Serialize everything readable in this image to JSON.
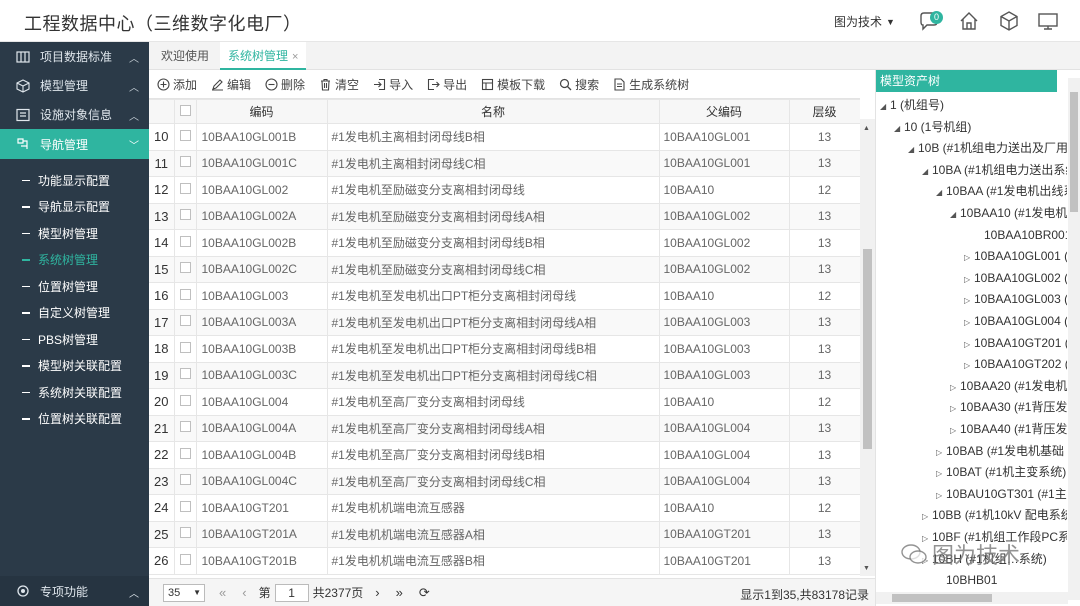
{
  "header": {
    "title": "工程数据中心（三维数字化电厂）",
    "user": "图为技术",
    "message_count": "0"
  },
  "sidebar": {
    "items": [
      {
        "label": "项目数据标准",
        "icon": "grid-icon"
      },
      {
        "label": "模型管理",
        "icon": "cube-icon"
      },
      {
        "label": "设施对象信息",
        "icon": "form-icon"
      },
      {
        "label": "导航管理",
        "icon": "navigation-icon"
      }
    ],
    "sub_items": [
      {
        "label": "功能显示配置"
      },
      {
        "label": "导航显示配置"
      },
      {
        "label": "模型树管理"
      },
      {
        "label": "系统树管理"
      },
      {
        "label": "位置树管理"
      },
      {
        "label": "自定义树管理"
      },
      {
        "label": "PBS树管理"
      },
      {
        "label": "模型树关联配置"
      },
      {
        "label": "系统树关联配置"
      },
      {
        "label": "位置树关联配置"
      }
    ],
    "bottom": {
      "label": "专项功能"
    }
  },
  "tabs": [
    {
      "label": "欢迎使用"
    },
    {
      "label": "系统树管理",
      "close": "×"
    }
  ],
  "toolbar": {
    "add": "添加",
    "edit": "编辑",
    "delete": "删除",
    "clear": "清空",
    "import": "导入",
    "export": "导出",
    "template": "模板下载",
    "search": "搜索",
    "generate": "生成系统树"
  },
  "table": {
    "headers": {
      "code": "编码",
      "name": "名称",
      "parent": "父编码",
      "level": "层级"
    },
    "rows": [
      {
        "n": "10",
        "code": "10BAA10GL001B",
        "name": "#1发电机主离相封闭母线B相",
        "parent": "10BAA10GL001",
        "level": "13"
      },
      {
        "n": "11",
        "code": "10BAA10GL001C",
        "name": "#1发电机主离相封闭母线C相",
        "parent": "10BAA10GL001",
        "level": "13"
      },
      {
        "n": "12",
        "code": "10BAA10GL002",
        "name": "#1发电机至励磁变分支离相封闭母线",
        "parent": "10BAA10",
        "level": "12"
      },
      {
        "n": "13",
        "code": "10BAA10GL002A",
        "name": "#1发电机至励磁变分支离相封闭母线A相",
        "parent": "10BAA10GL002",
        "level": "13"
      },
      {
        "n": "14",
        "code": "10BAA10GL002B",
        "name": "#1发电机至励磁变分支离相封闭母线B相",
        "parent": "10BAA10GL002",
        "level": "13"
      },
      {
        "n": "15",
        "code": "10BAA10GL002C",
        "name": "#1发电机至励磁变分支离相封闭母线C相",
        "parent": "10BAA10GL002",
        "level": "13"
      },
      {
        "n": "16",
        "code": "10BAA10GL003",
        "name": "#1发电机至发电机出口PT柜分支离相封闭母线",
        "parent": "10BAA10",
        "level": "12"
      },
      {
        "n": "17",
        "code": "10BAA10GL003A",
        "name": "#1发电机至发电机出口PT柜分支离相封闭母线A相",
        "parent": "10BAA10GL003",
        "level": "13"
      },
      {
        "n": "18",
        "code": "10BAA10GL003B",
        "name": "#1发电机至发电机出口PT柜分支离相封闭母线B相",
        "parent": "10BAA10GL003",
        "level": "13"
      },
      {
        "n": "19",
        "code": "10BAA10GL003C",
        "name": "#1发电机至发电机出口PT柜分支离相封闭母线C相",
        "parent": "10BAA10GL003",
        "level": "13"
      },
      {
        "n": "20",
        "code": "10BAA10GL004",
        "name": "#1发电机至高厂变分支离相封闭母线",
        "parent": "10BAA10",
        "level": "12"
      },
      {
        "n": "21",
        "code": "10BAA10GL004A",
        "name": "#1发电机至高厂变分支离相封闭母线A相",
        "parent": "10BAA10GL004",
        "level": "13"
      },
      {
        "n": "22",
        "code": "10BAA10GL004B",
        "name": "#1发电机至高厂变分支离相封闭母线B相",
        "parent": "10BAA10GL004",
        "level": "13"
      },
      {
        "n": "23",
        "code": "10BAA10GL004C",
        "name": "#1发电机至高厂变分支离相封闭母线C相",
        "parent": "10BAA10GL004",
        "level": "13"
      },
      {
        "n": "24",
        "code": "10BAA10GT201",
        "name": "#1发电机机端电流互感器",
        "parent": "10BAA10",
        "level": "12"
      },
      {
        "n": "25",
        "code": "10BAA10GT201A",
        "name": "#1发电机机端电流互感器A相",
        "parent": "10BAA10GT201",
        "level": "13"
      },
      {
        "n": "26",
        "code": "10BAA10GT201B",
        "name": "#1发电机机端电流互感器B相",
        "parent": "10BAA10GT201",
        "level": "13"
      }
    ]
  },
  "pager": {
    "page_size": "35",
    "page_label": "第",
    "page": "1",
    "total_pages": "共2377页",
    "summary": "显示1到35,共83178记录"
  },
  "tree": {
    "title": "模型资产树",
    "nodes": [
      {
        "label": "1 (机组号)",
        "toggle": "◢"
      },
      {
        "label": "10 (1号机组)",
        "toggle": "◢"
      },
      {
        "label": "10B (#1机组电力送出及厂用",
        "toggle": "◢"
      },
      {
        "label": "10BA (#1机组电力送出系统",
        "toggle": "◢"
      },
      {
        "label": "10BAA (#1发电机出线系",
        "toggle": "◢"
      },
      {
        "label": "10BAA10 (#1发电机",
        "toggle": "◢"
      },
      {
        "label": "10BAA10BR001",
        "toggle": ""
      },
      {
        "label": "10BAA10GL001 (",
        "toggle": "▷"
      },
      {
        "label": "10BAA10GL002 (",
        "toggle": "▷"
      },
      {
        "label": "10BAA10GL003 (",
        "toggle": "▷"
      },
      {
        "label": "10BAA10GL004 (",
        "toggle": "▷"
      },
      {
        "label": "10BAA10GT201 (",
        "toggle": "▷"
      },
      {
        "label": "10BAA10GT202 (",
        "toggle": "▷"
      },
      {
        "label": "10BAA20 (#1发电机",
        "toggle": "▷"
      },
      {
        "label": "10BAA30 (#1背压发",
        "toggle": "▷"
      },
      {
        "label": "10BAA40 (#1背压发",
        "toggle": "▷"
      },
      {
        "label": "10BAB (#1发电机基础",
        "toggle": "▷"
      },
      {
        "label": "10BAT (#1机主变系统)",
        "toggle": "▷"
      },
      {
        "label": "10BAU10GT301 (#1主",
        "toggle": "▷"
      },
      {
        "label": "10BB (#1机10kV 配电系统",
        "toggle": "▷"
      },
      {
        "label": "10BF (#1机组工作段PC系",
        "toggle": "▷"
      },
      {
        "label": "10BH (#1机组…系统)",
        "toggle": "▷"
      },
      {
        "label": "10BHB01",
        "toggle": ""
      }
    ]
  },
  "watermark": "图为技术",
  "colors": {
    "accent": "#2fb5a0",
    "sidebar_bg": "#2b3a48"
  }
}
